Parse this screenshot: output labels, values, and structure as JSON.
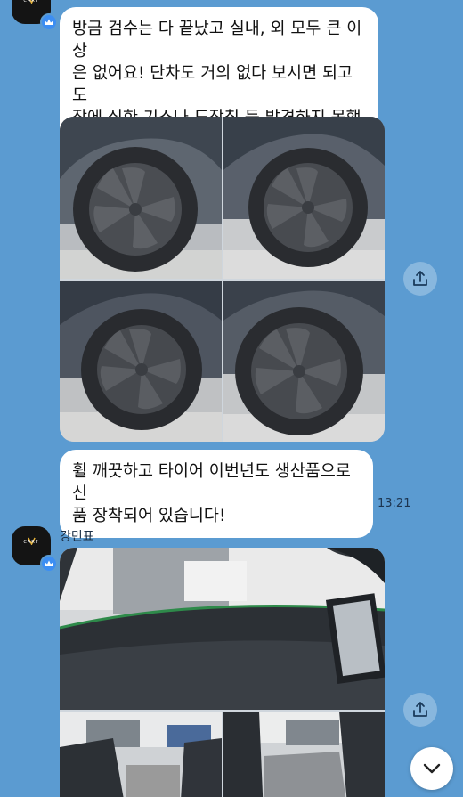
{
  "messages": [
    {
      "text": "방금 검수는 다 끝났고 실내, 외 모두 큰 이상\n은 없어요! 단차도 거의 없다 보시면 되고 도\n장에 심한 기스나 도장칩 등 발견하지 못했습\n니다!"
    },
    {
      "text": "휠 깨끗하고 타이어 이번년도 생산품으로 신\n품 장착되어 있습니다!",
      "time": "13:21"
    }
  ],
  "sender": {
    "name": "강민표",
    "avatar_text": "CARF"
  },
  "photos1": [
    "wheel-front-left",
    "wheel-front-right",
    "wheel-rear-left",
    "wheel-rear-right"
  ],
  "photos2": [
    "interior-dashboard",
    "door-left",
    "door-right"
  ],
  "icons": {
    "share": "share-icon",
    "scroll_down": "chevron-down-icon",
    "badge": "crown-icon"
  },
  "colors": {
    "background": "#5b9bd1",
    "bubble": "#ffffff",
    "badge": "#3d8ef2"
  }
}
